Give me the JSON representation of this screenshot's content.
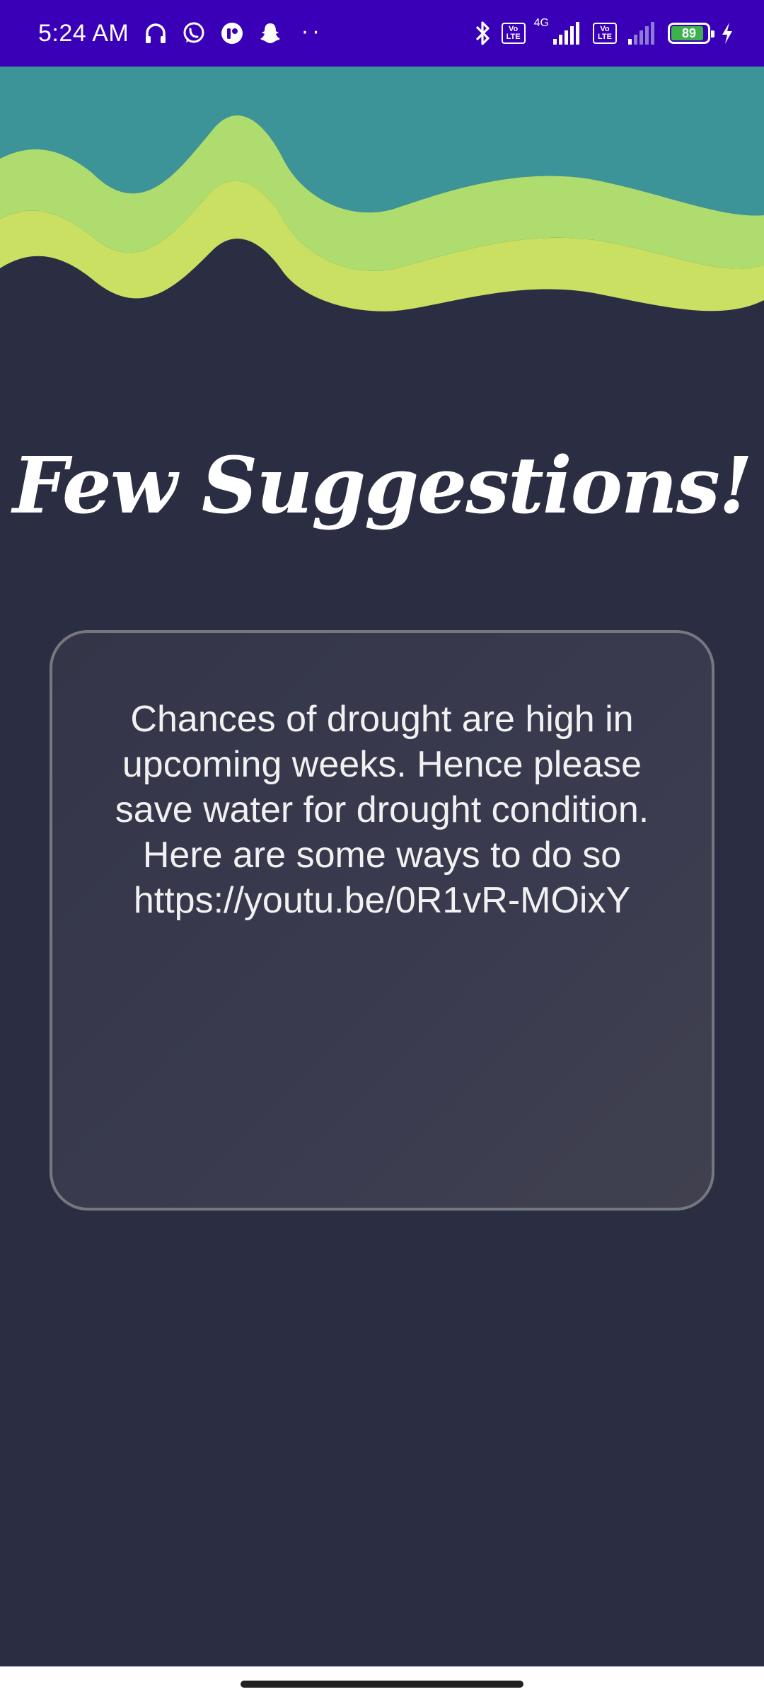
{
  "status_bar": {
    "time": "5:24 AM",
    "dots": "··",
    "network_type": "4G",
    "volte_top": "Vo",
    "volte_bottom": "LTE",
    "battery_level": "89",
    "battery_fraction": 0.89,
    "left_icons": [
      "headphones-icon",
      "whatsapp-icon",
      "app-icon",
      "snapchat-icon"
    ],
    "right_icons": [
      "bluetooth-icon",
      "volte-icon",
      "signal-icon",
      "volte-icon",
      "signal-weak-icon",
      "battery-icon",
      "charging-icon"
    ]
  },
  "header": {
    "wave_colors": [
      "#3d9498",
      "#aedc6e",
      "#c9e063"
    ]
  },
  "main": {
    "title": "Few Suggestions!",
    "message": "Chances of drought are high in upcoming weeks. Hence please save water for drought condition. Here are some ways to do so https://youtu.be/0R1vR-MOixY"
  },
  "colors": {
    "status_bar_bg": "#3a00b8",
    "background": "#2b2d42",
    "card_border": "#77777f",
    "text": "#ffffff"
  }
}
